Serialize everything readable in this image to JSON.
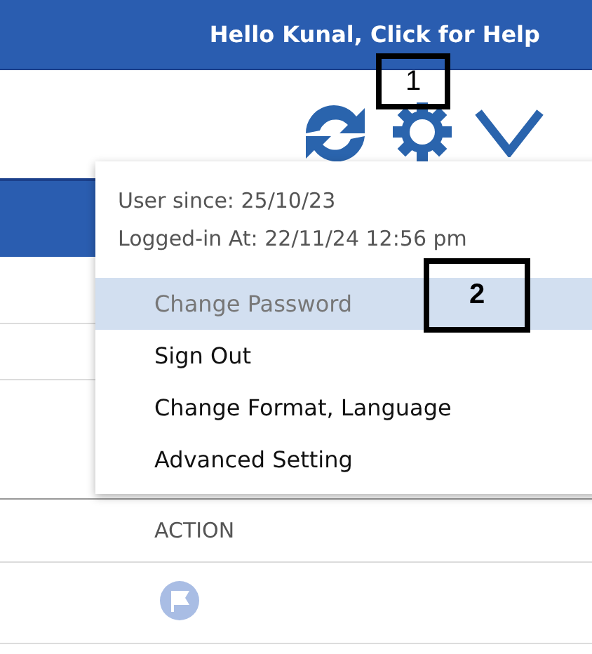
{
  "header": {
    "greeting": "Hello Kunal, Click for Help"
  },
  "menu": {
    "info": [
      "User since: 25/10/23",
      "Logged-in At: 22/11/24 12:56 pm"
    ],
    "items": [
      {
        "label": "Change Password",
        "selected": true
      },
      {
        "label": "Sign Out",
        "selected": false
      },
      {
        "label": "Change Format, Language",
        "selected": false
      },
      {
        "label": "Advanced Setting",
        "selected": false
      }
    ]
  },
  "table": {
    "columns": [
      "ACTION"
    ]
  },
  "annotations": [
    {
      "label": "1"
    },
    {
      "label": "2"
    }
  ]
}
